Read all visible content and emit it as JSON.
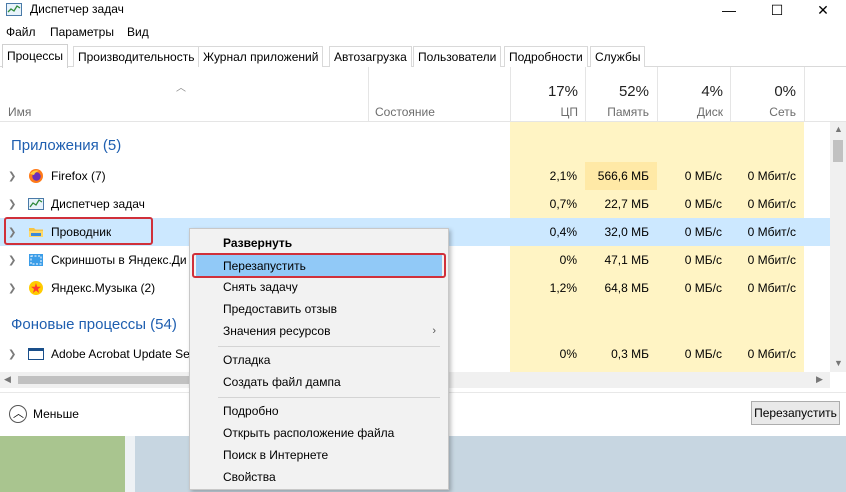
{
  "window": {
    "title": "Диспетчер задач",
    "controls": {
      "minimize": "—",
      "maximize": "☐",
      "close": "✕"
    }
  },
  "menubar": [
    "Файл",
    "Параметры",
    "Вид"
  ],
  "tabs": [
    "Процессы",
    "Производительность",
    "Журнал приложений",
    "Автозагрузка",
    "Пользователи",
    "Подробности",
    "Службы"
  ],
  "columns": {
    "name": "Имя",
    "status": "Состояние",
    "cpu": {
      "percent": "17%",
      "label": "ЦП"
    },
    "memory": {
      "percent": "52%",
      "label": "Память"
    },
    "disk": {
      "percent": "4%",
      "label": "Диск"
    },
    "network": {
      "percent": "0%",
      "label": "Сеть"
    }
  },
  "groups": {
    "apps": "Приложения (5)",
    "background": "Фоновые процессы (54)"
  },
  "processes": [
    {
      "name": "Firefox (7)",
      "icon": "firefox-icon",
      "cpu": "2,1%",
      "memory": "566,6 МБ",
      "disk": "0 МБ/с",
      "network": "0 Мбит/с"
    },
    {
      "name": "Диспетчер задач",
      "icon": "task-manager-icon",
      "cpu": "0,7%",
      "memory": "22,7 МБ",
      "disk": "0 МБ/с",
      "network": "0 Мбит/с"
    },
    {
      "name": "Проводник",
      "icon": "explorer-folder-icon",
      "cpu": "0,4%",
      "memory": "32,0 МБ",
      "disk": "0 МБ/с",
      "network": "0 Мбит/с"
    },
    {
      "name": "Скриншоты в Яндекс.Ди",
      "icon": "yandex-disk-screenshot-icon",
      "cpu": "0%",
      "memory": "47,1 МБ",
      "disk": "0 МБ/с",
      "network": "0 Мбит/с"
    },
    {
      "name": "Яндекс.Музыка (2)",
      "icon": "yandex-music-icon",
      "cpu": "1,2%",
      "memory": "64,8 МБ",
      "disk": "0 МБ/с",
      "network": "0 Мбит/с"
    }
  ],
  "background_processes": [
    {
      "name": "Adobe Acrobat Update Se",
      "icon": "adobe-window-icon",
      "cpu": "0%",
      "memory": "0,3 МБ",
      "disk": "0 МБ/с",
      "network": "0 Мбит/с"
    }
  ],
  "context_menu": {
    "items": [
      "Развернуть",
      "Перезапустить",
      "Снять задачу",
      "Предоставить отзыв",
      "Значения ресурсов",
      "Отладка",
      "Создать файл дампа",
      "Подробно",
      "Открыть расположение файла",
      "Поиск в Интернете",
      "Свойства"
    ],
    "submenu_arrow": "›"
  },
  "footer": {
    "less_label": "Меньше",
    "restart_button": "Перезапустить"
  },
  "colors": {
    "accent_group": "#1f5fb0",
    "selection": "#cce8ff",
    "menu_hover": "#91c9f7",
    "highlight_outline": "#d0303a",
    "heat_light": "#fff4c4",
    "heat_medium": "#ffe9a6"
  }
}
